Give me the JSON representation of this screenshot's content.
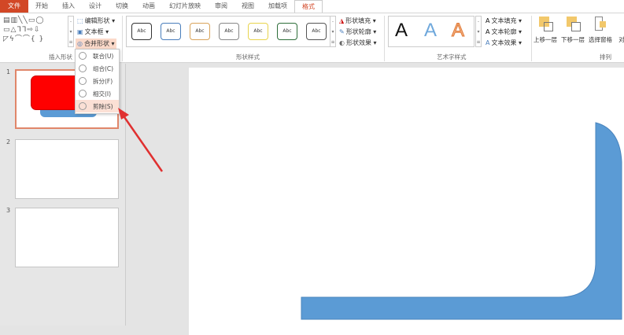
{
  "tabs": [
    "文件",
    "开始",
    "插入",
    "设计",
    "切换",
    "动画",
    "幻灯片放映",
    "审阅",
    "视图",
    "加载项",
    "格式"
  ],
  "ribbon": {
    "insert_shapes": {
      "label": "插入形状",
      "edit_shape": "编辑形状 ▾",
      "text_box": "文本框 ▾",
      "merge_shapes": "合并形状 ▾"
    },
    "shape_styles": {
      "label": "形状样式",
      "preset": [
        "Abc",
        "Abc",
        "Abc",
        "Abc",
        "Abc",
        "Abc",
        "Abc"
      ],
      "preset_colors": [
        "#333333",
        "#4a7ebb",
        "#d9a45b",
        "#888888",
        "#e8d44d",
        "#2e6e3a",
        "#555555"
      ],
      "fill": "形状填充 ▾",
      "outline": "形状轮廓 ▾",
      "effects": "形状效果 ▾"
    },
    "wordart": {
      "label": "艺术字样式",
      "letters": [
        "A",
        "A",
        "A"
      ],
      "text_fill": "文本填充 ▾",
      "text_outline": "文本轮廓 ▾",
      "text_effects": "文本效果 ▾"
    },
    "arrange": {
      "label": "排列",
      "bring_forward": "上移一层",
      "send_backward": "下移一层",
      "selection_pane": "选择窗格",
      "align": "对"
    }
  },
  "merge_menu": [
    "联合(U)",
    "组合(C)",
    "拆分(F)",
    "相交(I)",
    "剪除(S)"
  ],
  "slides": [
    "1",
    "2",
    "3"
  ],
  "colors": {
    "accent": "#d24726",
    "shape_blue": "#5b9bd5",
    "shape_red": "#ff0000"
  }
}
